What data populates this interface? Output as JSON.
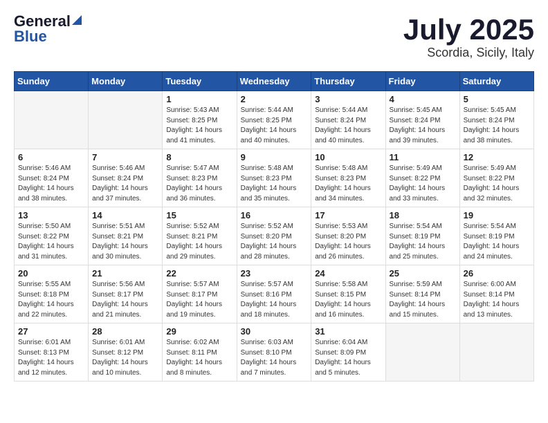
{
  "logo": {
    "general": "General",
    "blue": "Blue"
  },
  "title": "July 2025",
  "location": "Scordia, Sicily, Italy",
  "days_header": [
    "Sunday",
    "Monday",
    "Tuesday",
    "Wednesday",
    "Thursday",
    "Friday",
    "Saturday"
  ],
  "weeks": [
    [
      {
        "day": "",
        "text": ""
      },
      {
        "day": "",
        "text": ""
      },
      {
        "day": "1",
        "text": "Sunrise: 5:43 AM\nSunset: 8:25 PM\nDaylight: 14 hours\nand 41 minutes."
      },
      {
        "day": "2",
        "text": "Sunrise: 5:44 AM\nSunset: 8:25 PM\nDaylight: 14 hours\nand 40 minutes."
      },
      {
        "day": "3",
        "text": "Sunrise: 5:44 AM\nSunset: 8:24 PM\nDaylight: 14 hours\nand 40 minutes."
      },
      {
        "day": "4",
        "text": "Sunrise: 5:45 AM\nSunset: 8:24 PM\nDaylight: 14 hours\nand 39 minutes."
      },
      {
        "day": "5",
        "text": "Sunrise: 5:45 AM\nSunset: 8:24 PM\nDaylight: 14 hours\nand 38 minutes."
      }
    ],
    [
      {
        "day": "6",
        "text": "Sunrise: 5:46 AM\nSunset: 8:24 PM\nDaylight: 14 hours\nand 38 minutes."
      },
      {
        "day": "7",
        "text": "Sunrise: 5:46 AM\nSunset: 8:24 PM\nDaylight: 14 hours\nand 37 minutes."
      },
      {
        "day": "8",
        "text": "Sunrise: 5:47 AM\nSunset: 8:23 PM\nDaylight: 14 hours\nand 36 minutes."
      },
      {
        "day": "9",
        "text": "Sunrise: 5:48 AM\nSunset: 8:23 PM\nDaylight: 14 hours\nand 35 minutes."
      },
      {
        "day": "10",
        "text": "Sunrise: 5:48 AM\nSunset: 8:23 PM\nDaylight: 14 hours\nand 34 minutes."
      },
      {
        "day": "11",
        "text": "Sunrise: 5:49 AM\nSunset: 8:22 PM\nDaylight: 14 hours\nand 33 minutes."
      },
      {
        "day": "12",
        "text": "Sunrise: 5:49 AM\nSunset: 8:22 PM\nDaylight: 14 hours\nand 32 minutes."
      }
    ],
    [
      {
        "day": "13",
        "text": "Sunrise: 5:50 AM\nSunset: 8:22 PM\nDaylight: 14 hours\nand 31 minutes."
      },
      {
        "day": "14",
        "text": "Sunrise: 5:51 AM\nSunset: 8:21 PM\nDaylight: 14 hours\nand 30 minutes."
      },
      {
        "day": "15",
        "text": "Sunrise: 5:52 AM\nSunset: 8:21 PM\nDaylight: 14 hours\nand 29 minutes."
      },
      {
        "day": "16",
        "text": "Sunrise: 5:52 AM\nSunset: 8:20 PM\nDaylight: 14 hours\nand 28 minutes."
      },
      {
        "day": "17",
        "text": "Sunrise: 5:53 AM\nSunset: 8:20 PM\nDaylight: 14 hours\nand 26 minutes."
      },
      {
        "day": "18",
        "text": "Sunrise: 5:54 AM\nSunset: 8:19 PM\nDaylight: 14 hours\nand 25 minutes."
      },
      {
        "day": "19",
        "text": "Sunrise: 5:54 AM\nSunset: 8:19 PM\nDaylight: 14 hours\nand 24 minutes."
      }
    ],
    [
      {
        "day": "20",
        "text": "Sunrise: 5:55 AM\nSunset: 8:18 PM\nDaylight: 14 hours\nand 22 minutes."
      },
      {
        "day": "21",
        "text": "Sunrise: 5:56 AM\nSunset: 8:17 PM\nDaylight: 14 hours\nand 21 minutes."
      },
      {
        "day": "22",
        "text": "Sunrise: 5:57 AM\nSunset: 8:17 PM\nDaylight: 14 hours\nand 19 minutes."
      },
      {
        "day": "23",
        "text": "Sunrise: 5:57 AM\nSunset: 8:16 PM\nDaylight: 14 hours\nand 18 minutes."
      },
      {
        "day": "24",
        "text": "Sunrise: 5:58 AM\nSunset: 8:15 PM\nDaylight: 14 hours\nand 16 minutes."
      },
      {
        "day": "25",
        "text": "Sunrise: 5:59 AM\nSunset: 8:14 PM\nDaylight: 14 hours\nand 15 minutes."
      },
      {
        "day": "26",
        "text": "Sunrise: 6:00 AM\nSunset: 8:14 PM\nDaylight: 14 hours\nand 13 minutes."
      }
    ],
    [
      {
        "day": "27",
        "text": "Sunrise: 6:01 AM\nSunset: 8:13 PM\nDaylight: 14 hours\nand 12 minutes."
      },
      {
        "day": "28",
        "text": "Sunrise: 6:01 AM\nSunset: 8:12 PM\nDaylight: 14 hours\nand 10 minutes."
      },
      {
        "day": "29",
        "text": "Sunrise: 6:02 AM\nSunset: 8:11 PM\nDaylight: 14 hours\nand 8 minutes."
      },
      {
        "day": "30",
        "text": "Sunrise: 6:03 AM\nSunset: 8:10 PM\nDaylight: 14 hours\nand 7 minutes."
      },
      {
        "day": "31",
        "text": "Sunrise: 6:04 AM\nSunset: 8:09 PM\nDaylight: 14 hours\nand 5 minutes."
      },
      {
        "day": "",
        "text": ""
      },
      {
        "day": "",
        "text": ""
      }
    ]
  ]
}
